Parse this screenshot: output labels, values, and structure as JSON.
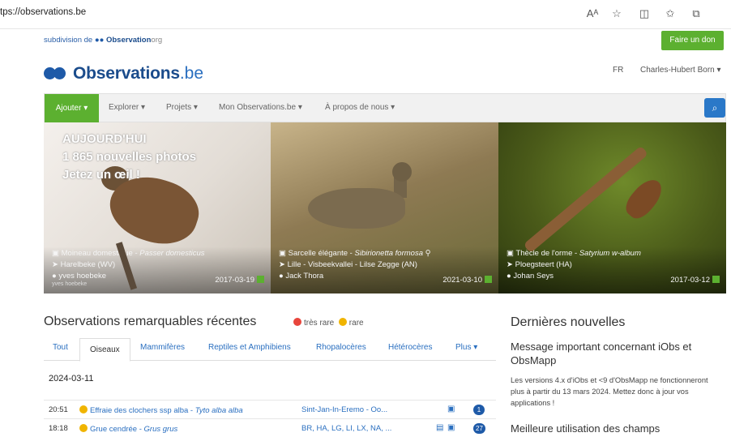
{
  "browser": {
    "url": "tps://observations.be",
    "icons": [
      "read-aloud-icon",
      "favorite-star-icon",
      "split-screen-icon",
      "favorites-icon",
      "collections-icon"
    ]
  },
  "topbar": {
    "subdivision_prefix": "subdivision de",
    "subdivision_brand": "Observation",
    "subdivision_tld": "org",
    "donate_label": "Faire un don"
  },
  "header": {
    "logo_name": "Observations",
    "logo_tld": ".be",
    "lang": "FR",
    "user": "Charles-Hubert Born ▾"
  },
  "nav": {
    "add_label": "Ajouter ▾",
    "items": [
      "Explorer ▾",
      "Projets ▾",
      "Mon Observations.be ▾",
      "À propos de nous ▾"
    ],
    "search_icon": "search-icon"
  },
  "hero": {
    "today": "AUJOURD'HUI",
    "new_photos": "1 865 nouvelles photos",
    "cta": "Jetez un œil !"
  },
  "photos": [
    {
      "species": "Moineau domestique",
      "latin": "Passer domesticus",
      "location": "Harelbeke (WV)",
      "observer": "yves hoebeke",
      "date": "2017-03-19",
      "credit": "yves hoebeke"
    },
    {
      "species": "Sarcelle élégante",
      "latin": "Sibirionetta formosa",
      "location": "Lille - Visbeekvallei - Lilse Zegge (AN)",
      "observer": "Jack Thora",
      "date": "2021-03-10"
    },
    {
      "species": "Thècle de l'orme",
      "latin": "Satyrium w-album",
      "location": "Ploegsteert (HA)",
      "observer": "Johan Seys",
      "date": "2017-03-12"
    }
  ],
  "observations": {
    "title": "Observations remarquables récentes",
    "legend_very_rare": "très rare",
    "legend_rare": "rare",
    "tabs": [
      "Tout",
      "Oiseaux",
      "Mammifères",
      "Reptiles et Amphibiens",
      "Rhopalocères",
      "Hétérocères",
      "Plus ▾"
    ],
    "active_tab": "Oiseaux",
    "date": "2024-03-11",
    "rows": [
      {
        "time": "20:51",
        "species": "Effraie des clochers ssp alba",
        "latin": "Tyto alba alba",
        "location": "Sint-Jan-In-Eremo - Oo...",
        "count": "1",
        "rarity": "rare"
      },
      {
        "time": "18:18",
        "species": "Grue cendrée",
        "latin": "Grus grus",
        "location": "BR, HA, LG, LI, LX, NA, ...",
        "count": "27",
        "rarity": "rare"
      }
    ]
  },
  "news": {
    "title": "Dernières nouvelles",
    "item1_title": "Message important concernant iObs et ObsMapp",
    "item1_body": "Les versions 4.x d'iObs et <9 d'ObsMapp ne fonctionneront plus à partir du 13 mars 2024. Mettez donc à jour vos applications !",
    "item2_title": "Meilleure utilisation des champs"
  },
  "colors": {
    "green": "#5cb030",
    "blue": "#1e5aa8",
    "link": "#2a6fc0",
    "very_rare": "#e8453c",
    "rare": "#f0b400"
  }
}
